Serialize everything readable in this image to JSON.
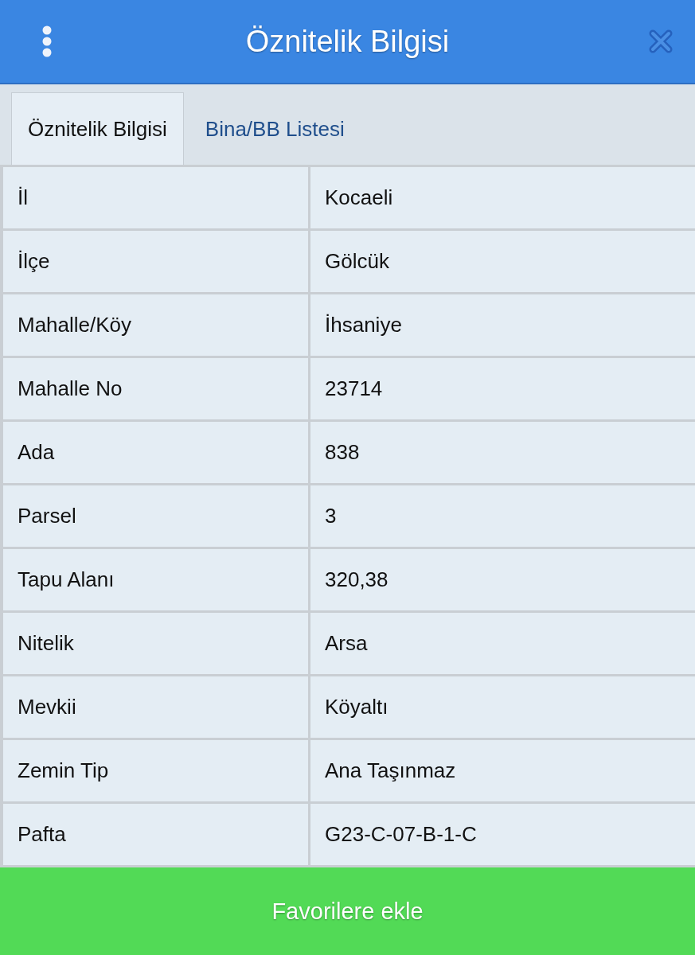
{
  "header": {
    "title": "Öznitelik Bilgisi"
  },
  "tabs": [
    {
      "label": "Öznitelik Bilgisi",
      "selected": true
    },
    {
      "label": "Bina/BB Listesi",
      "selected": false
    }
  ],
  "attributes": [
    {
      "label": "İl",
      "value": "Kocaeli"
    },
    {
      "label": "İlçe",
      "value": "Gölcük"
    },
    {
      "label": "Mahalle/Köy",
      "value": "İhsaniye"
    },
    {
      "label": "Mahalle No",
      "value": "23714"
    },
    {
      "label": "Ada",
      "value": "838"
    },
    {
      "label": "Parsel",
      "value": "3"
    },
    {
      "label": "Tapu Alanı",
      "value": "320,38"
    },
    {
      "label": "Nitelik",
      "value": "Arsa"
    },
    {
      "label": "Mevkii",
      "value": "Köyaltı"
    },
    {
      "label": "Zemin Tip",
      "value": "Ana Taşınmaz"
    },
    {
      "label": "Pafta",
      "value": "G23-C-07-B-1-C"
    }
  ],
  "button": {
    "label": "Favorilere ekle"
  }
}
